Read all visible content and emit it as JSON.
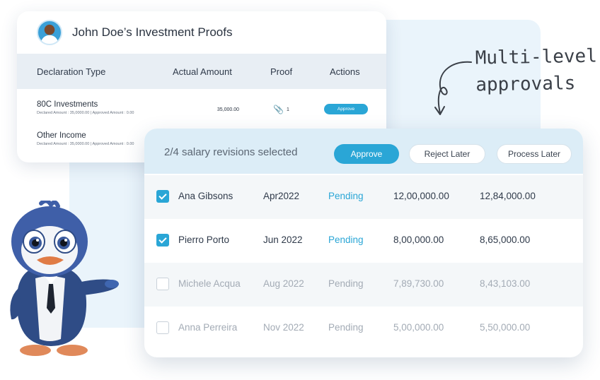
{
  "proofs": {
    "title": "John Doe’s Investment Proofs",
    "columns": [
      "Declaration Type",
      "Actual Amount",
      "Proof",
      "Actions"
    ],
    "rows": [
      {
        "name": "80C Investments",
        "detail": "Declared Amount : 35,0000.00 | Approved Amount : 0.00",
        "amount": "35,000.00",
        "proof_count": "1",
        "action": "Approve"
      },
      {
        "name": "Other Income",
        "detail": "Declared Amount : 35,0000.00 | Approved Amount : 0.00"
      }
    ]
  },
  "annotation": {
    "line1": "Multi-level",
    "line2": "approvals"
  },
  "salary": {
    "selection_text": "2/4 salary revisions selected",
    "buttons": {
      "approve": "Approve",
      "reject_later": "Reject Later",
      "process_later": "Process Later"
    },
    "rows": [
      {
        "name": "Ana Gibsons",
        "period": "Apr2022",
        "status": "Pending",
        "current": "12,00,000.00",
        "revised": "12,84,000.00",
        "checked": true
      },
      {
        "name": "Pierro Porto",
        "period": "Jun 2022",
        "status": "Pending",
        "current": "8,00,000.00",
        "revised": "8,65,000.00",
        "checked": true
      },
      {
        "name": "Michele Acqua",
        "period": "Aug 2022",
        "status": "Pending",
        "current": "7,89,730.00",
        "revised": "8,43,103.00",
        "checked": false
      },
      {
        "name": "Anna Perreira",
        "period": "Nov 2022",
        "status": "Pending",
        "current": "5,00,000.00",
        "revised": "5,50,000.00",
        "checked": false
      }
    ]
  },
  "colors": {
    "accent": "#2aa6d6",
    "header_bg": "#dcedf7",
    "panel_bg": "#eaf4fb"
  },
  "icons": [
    "avatar",
    "paperclip-icon",
    "curved-arrow-icon",
    "checkbox-icon",
    "penguin-mascot"
  ]
}
